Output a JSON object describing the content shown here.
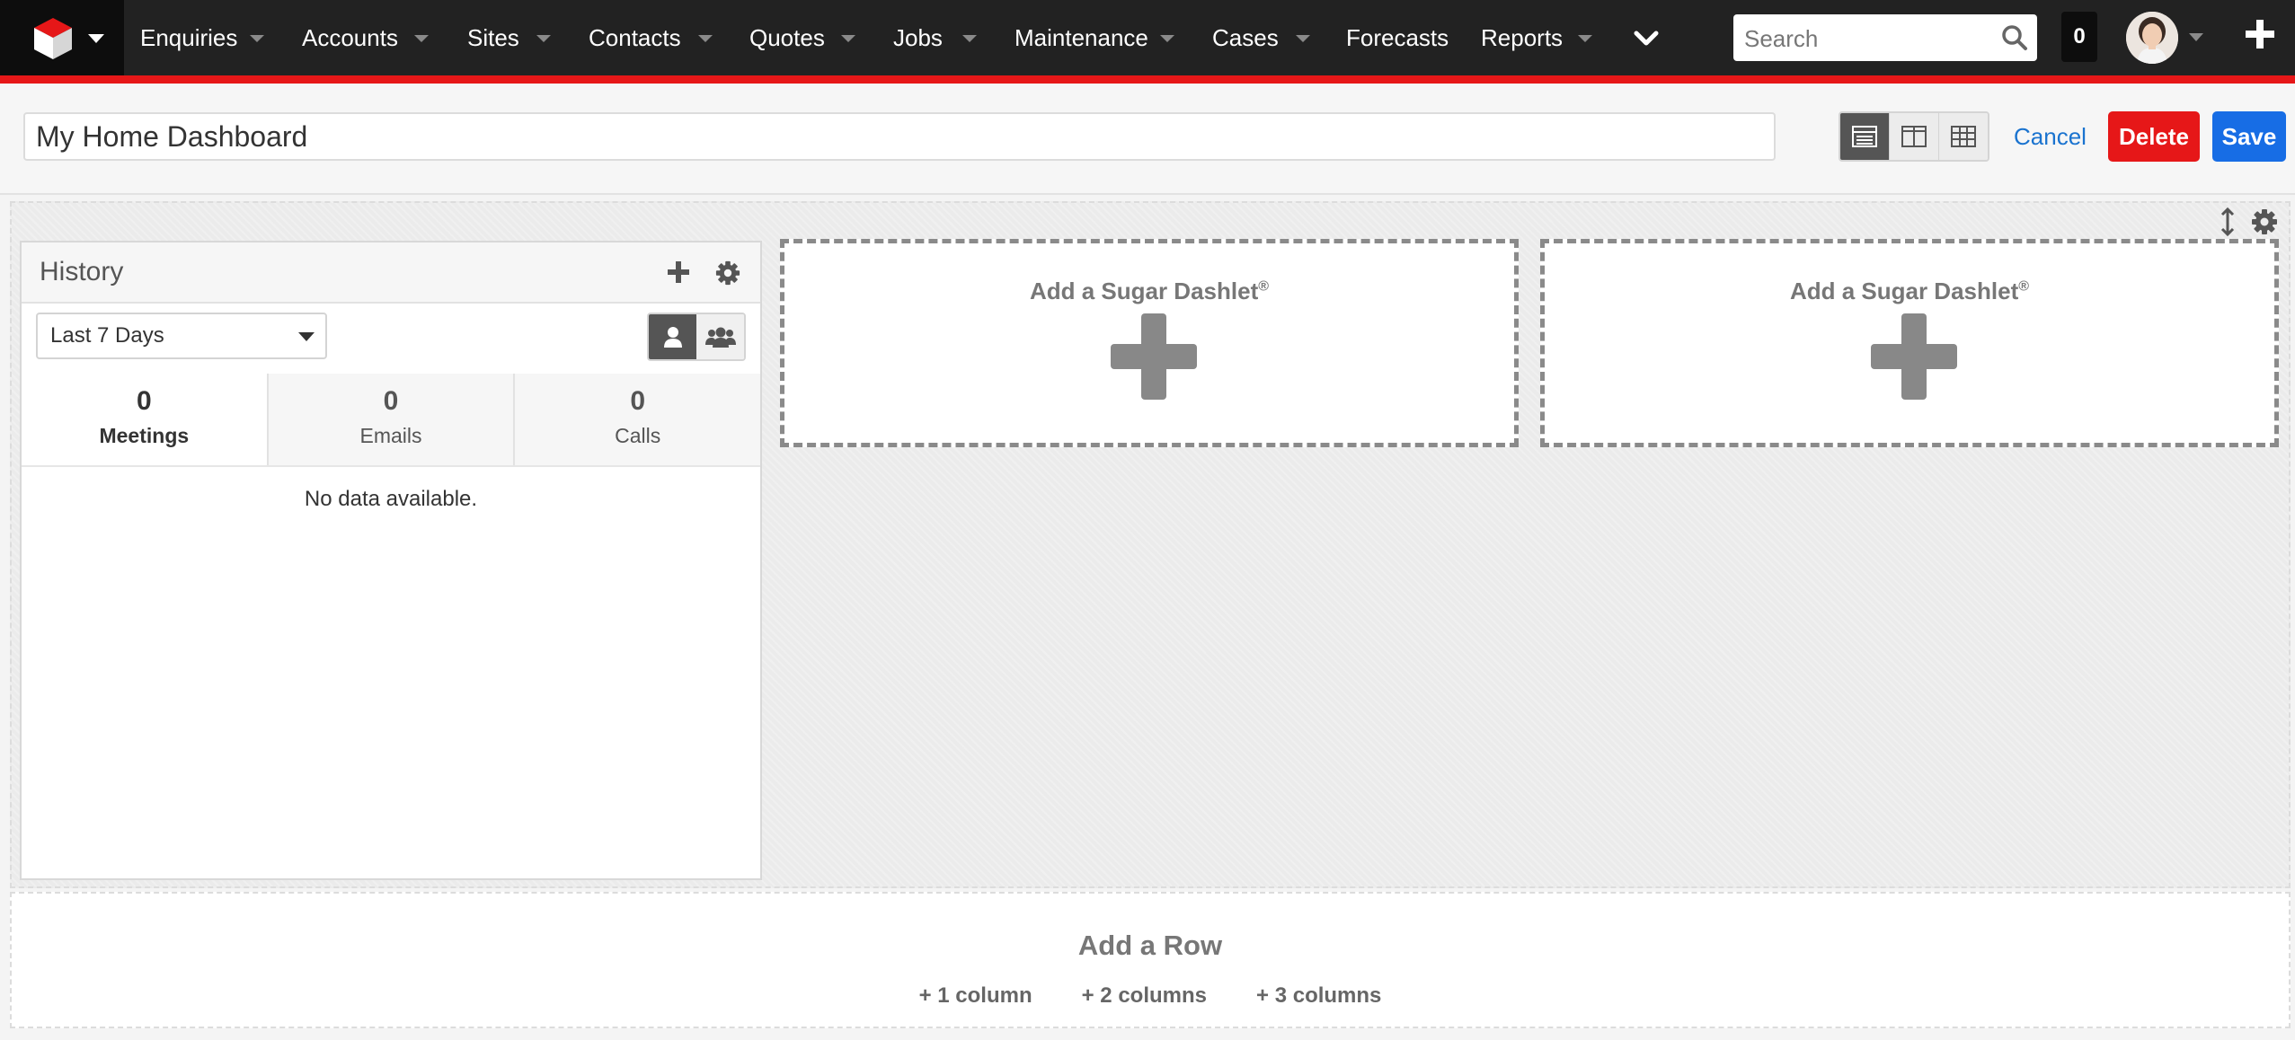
{
  "nav": {
    "items": [
      {
        "label": "Enquiries"
      },
      {
        "label": "Accounts"
      },
      {
        "label": "Sites"
      },
      {
        "label": "Contacts"
      },
      {
        "label": "Quotes"
      },
      {
        "label": "Jobs"
      },
      {
        "label": "Maintenance"
      },
      {
        "label": "Cases"
      },
      {
        "label": "Forecasts"
      },
      {
        "label": "Reports"
      }
    ],
    "search_placeholder": "Search",
    "notification_count": "0",
    "icons": {
      "logo": "sugar-cube-icon",
      "more": "chevron-down-icon",
      "search": "search-icon",
      "quick_create": "plus-icon"
    },
    "colors": {
      "bar": "#222222",
      "accent": "#e61718"
    }
  },
  "header": {
    "dashboard_name": "My Home Dashboard",
    "layout_icons": [
      "list-layout-icon",
      "two-column-layout-icon",
      "grid-layout-icon"
    ],
    "cancel_label": "Cancel",
    "delete_label": "Delete",
    "save_label": "Save",
    "colors": {
      "delete": "#e61718",
      "save": "#176de5",
      "cancel": "#1a73cf"
    }
  },
  "history_dashlet": {
    "title": "History",
    "filter_value": "Last 7 Days",
    "tabs": [
      {
        "count": "0",
        "label": "Meetings"
      },
      {
        "count": "0",
        "label": "Emails"
      },
      {
        "count": "0",
        "label": "Calls"
      }
    ],
    "empty_text": "No data available."
  },
  "add_dashlet": {
    "label": "Add a Sugar Dashlet",
    "mark": "®"
  },
  "add_row": {
    "title": "Add a Row",
    "options": [
      "+ 1 column",
      "+ 2 columns",
      "+ 3 columns"
    ]
  }
}
